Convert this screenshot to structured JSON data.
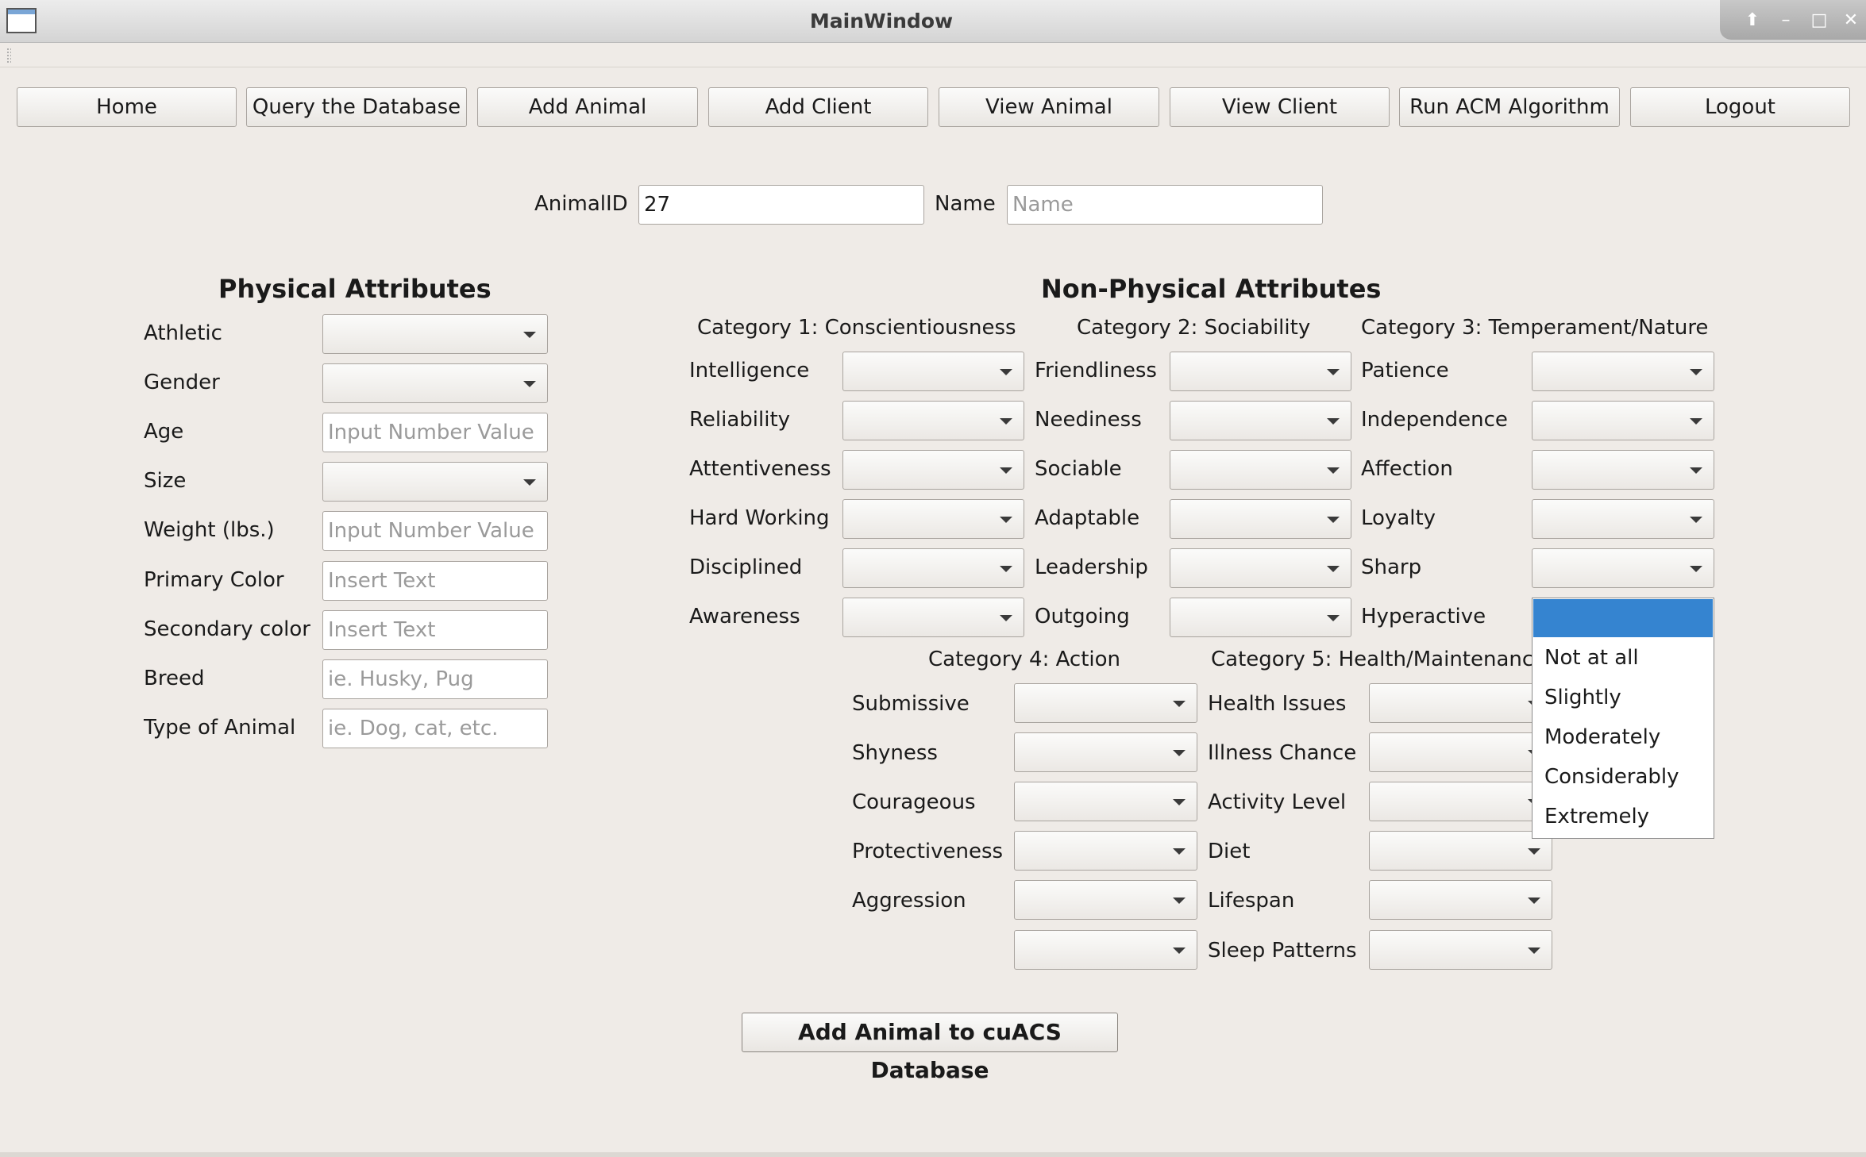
{
  "window": {
    "title": "MainWindow"
  },
  "nav": [
    "Home",
    "Query the Database",
    "Add Animal",
    "Add Client",
    "View Animal",
    "View Client",
    "Run ACM Algorithm",
    "Logout"
  ],
  "identity": {
    "animal_id_label": "AnimalID",
    "animal_id_value": "27",
    "name_label": "Name",
    "name_placeholder": "Name"
  },
  "physical": {
    "heading": "Physical Attributes",
    "fields": [
      {
        "label": "Athletic",
        "type": "combo",
        "value": ""
      },
      {
        "label": "Gender",
        "type": "combo",
        "value": ""
      },
      {
        "label": "Age",
        "type": "text",
        "placeholder": "Input Number Value"
      },
      {
        "label": "Size",
        "type": "combo",
        "value": ""
      },
      {
        "label": "Weight (lbs.)",
        "type": "text",
        "placeholder": "Input Number Value"
      },
      {
        "label": "Primary Color",
        "type": "text",
        "placeholder": "Insert Text"
      },
      {
        "label": "Secondary color",
        "type": "text",
        "placeholder": "Insert Text"
      },
      {
        "label": "Breed",
        "type": "text",
        "placeholder": "ie. Husky, Pug"
      },
      {
        "label": "Type of Animal",
        "type": "text",
        "placeholder": "ie. Dog, cat, etc."
      }
    ]
  },
  "nonphysical": {
    "heading": "Non-Physical Attributes",
    "categories": [
      {
        "title": "Category 1: Conscientiousness",
        "items": [
          "Intelligence",
          "Reliability",
          "Attentiveness",
          "Hard Working",
          "Disciplined",
          "Awareness"
        ]
      },
      {
        "title": "Category 2: Sociability",
        "items": [
          "Friendliness",
          "Neediness",
          "Sociable",
          "Adaptable",
          "Leadership",
          "Outgoing"
        ]
      },
      {
        "title": "Category 3: Temperament/Nature",
        "items": [
          "Patience",
          "Independence",
          "Affection",
          "Loyalty",
          "Sharp",
          "Hyperactive"
        ]
      },
      {
        "title": "Category 4: Action",
        "items": [
          "Submissive",
          "Shyness",
          "Courageous",
          "Protectiveness",
          "Aggression",
          ""
        ]
      },
      {
        "title": "Category 5: Health/Maintenance",
        "items": [
          "Health Issues",
          "Illness Chance",
          "Activity Level",
          "Diet",
          "Lifespan",
          "Sleep Patterns"
        ]
      }
    ]
  },
  "dropdown_popup": {
    "selected": "",
    "options": [
      "Not at all",
      "Slightly",
      "Moderately",
      "Considerably",
      "Extremely"
    ]
  },
  "submit_label": "Add Animal to cuACS Database"
}
